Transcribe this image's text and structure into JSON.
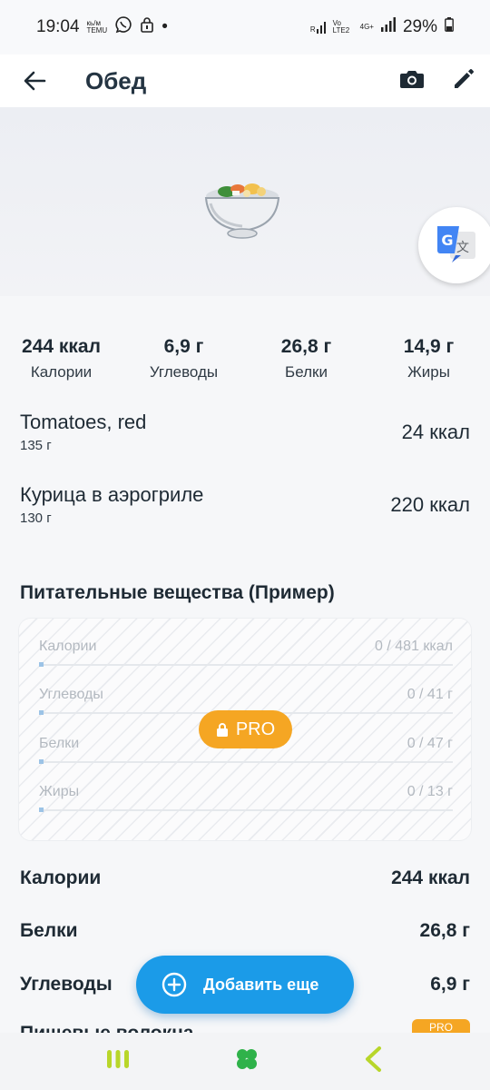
{
  "status": {
    "time": "19:04",
    "left_tiny_1": "кь/м",
    "left_tiny_2": "TEMU",
    "dot": "•",
    "signal_1": "R",
    "volte": "Vo LTE2",
    "net": "4G+",
    "battery": "29%"
  },
  "appbar": {
    "title": "Обед"
  },
  "macros": [
    {
      "value": "244 ккал",
      "label": "Калории"
    },
    {
      "value": "6,9 г",
      "label": "Углеводы"
    },
    {
      "value": "26,8 г",
      "label": "Белки"
    },
    {
      "value": "14,9 г",
      "label": "Жиры"
    }
  ],
  "foods": [
    {
      "name": "Tomatoes, red",
      "amount": "135 г",
      "kcal": "24 ккал"
    },
    {
      "name": "Курица в аэрогриле",
      "amount": "130 г",
      "kcal": "220 ккал"
    }
  ],
  "nutrients_section": {
    "title": "Питательные вещества (Пример)",
    "rows": [
      {
        "label": "Калории",
        "value": "0 / 481 ккал"
      },
      {
        "label": "Углеводы",
        "value": "0 / 41 г"
      },
      {
        "label": "Белки",
        "value": "0 / 47 г"
      },
      {
        "label": "Жиры",
        "value": "0 / 13 г"
      }
    ],
    "pro_label": "PRO"
  },
  "summary": [
    {
      "label": "Калории",
      "value": "244 ккал"
    },
    {
      "label": "Белки",
      "value": "26,8 г"
    },
    {
      "label": "Углеводы",
      "value": "6,9 г"
    }
  ],
  "fiber_label": "Пищевые волокна",
  "fiber_pro": "PRO",
  "add_button": {
    "label": "Добавить еще"
  },
  "colors": {
    "accent_blue": "#1b9be8",
    "pro_orange": "#f5a623",
    "nav_green": "#2fb24a",
    "nav_yellow_green": "#b8d62a"
  }
}
